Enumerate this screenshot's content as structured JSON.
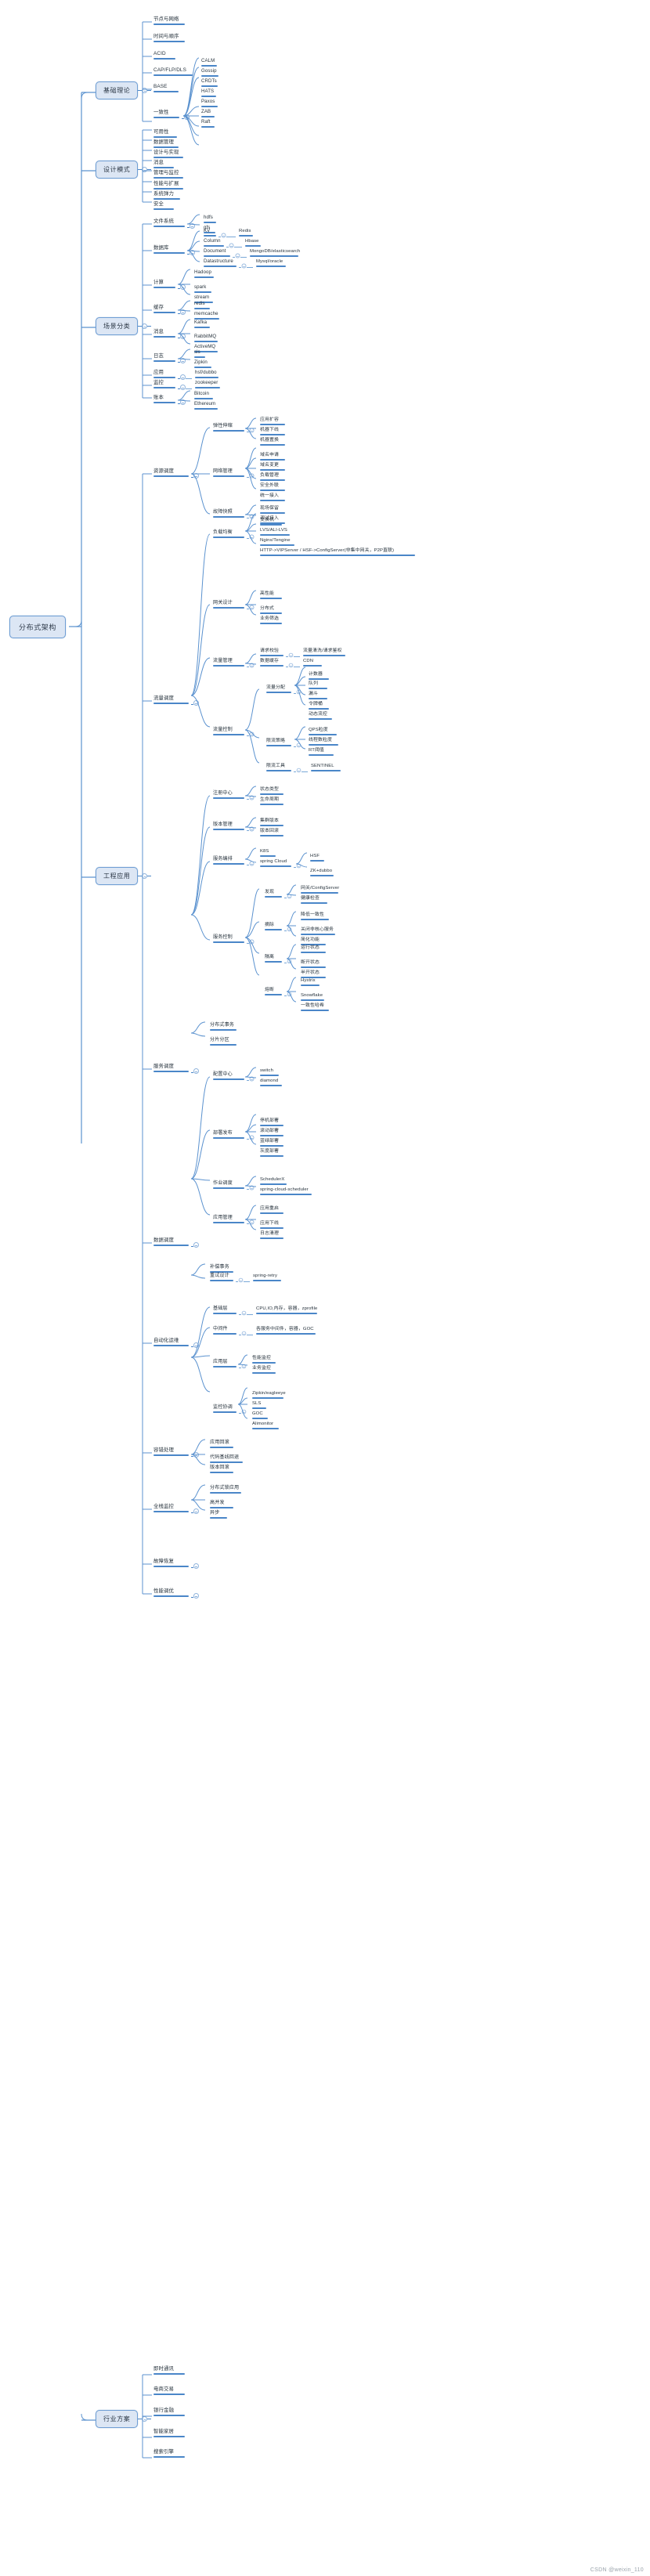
{
  "root": {
    "label": "分布式架构"
  },
  "watermark": "CSDN @weixin_110",
  "colors": {
    "branch": "#4a86c8",
    "pill_fill": "#dce6f4",
    "pill_border": "#6f9ed4",
    "text": "#26323c"
  },
  "branches": [
    {
      "id": "basic-theory",
      "label": "基础理论",
      "children": [
        {
          "label": "节点与网络"
        },
        {
          "label": "时间与顺序"
        },
        {
          "label": "ACID"
        },
        {
          "label": "CAP/FLP/DLS"
        },
        {
          "label": "BASE"
        },
        {
          "label": "一致性",
          "children": [
            {
              "label": "CALM"
            },
            {
              "label": "Gossip"
            },
            {
              "label": "CRDTs"
            },
            {
              "label": "HATS"
            },
            {
              "label": "Paxos"
            },
            {
              "label": "ZAB"
            },
            {
              "label": "Raft"
            }
          ]
        }
      ]
    },
    {
      "id": "design-pattern",
      "label": "设计模式",
      "children": [
        {
          "label": "可用性"
        },
        {
          "label": "数据管理"
        },
        {
          "label": "设计与实现"
        },
        {
          "label": "消息"
        },
        {
          "label": "管理与监控"
        },
        {
          "label": "性能与扩展"
        },
        {
          "label": "系统弹力"
        },
        {
          "label": "安全"
        }
      ]
    },
    {
      "id": "scenario",
      "label": "场景分类",
      "children": [
        {
          "label": "文件系统",
          "children": [
            {
              "label": "hdfs"
            },
            {
              "label": "gfs"
            }
          ]
        },
        {
          "label": "数据库",
          "children": [
            {
              "label": "KV",
              "children": [
                {
                  "label": "Redis"
                }
              ]
            },
            {
              "label": "Column",
              "children": [
                {
                  "label": "Hbase"
                }
              ]
            },
            {
              "label": "Document",
              "children": [
                {
                  "label": "MongoDB/elasticsearch"
                }
              ]
            },
            {
              "label": "Datastructure",
              "children": [
                {
                  "label": "Mysql/oracle"
                }
              ]
            }
          ]
        },
        {
          "label": "计算",
          "children": [
            {
              "label": "Hadoop"
            },
            {
              "label": "spark"
            },
            {
              "label": "stream"
            }
          ]
        },
        {
          "label": "缓存",
          "children": [
            {
              "label": "redis"
            },
            {
              "label": "memcache"
            }
          ]
        },
        {
          "label": "消息",
          "children": [
            {
              "label": "Kafka"
            },
            {
              "label": "RabbitMQ"
            },
            {
              "label": "ActiveMQ"
            }
          ]
        },
        {
          "label": "日志",
          "children": [
            {
              "label": "sls"
            },
            {
              "label": "Zipkin"
            }
          ]
        },
        {
          "label": "应用",
          "children": [
            {
              "label": "hsf/dubbo"
            }
          ]
        },
        {
          "label": "监控",
          "children": [
            {
              "label": "zookeeper"
            }
          ]
        },
        {
          "label": "账本",
          "children": [
            {
              "label": "Bitcoin"
            },
            {
              "label": "Ethereum"
            }
          ]
        }
      ]
    },
    {
      "id": "engineering",
      "label": "工程应用",
      "children": [
        {
          "label": "资源调度",
          "children": [
            {
              "label": "弹性伸缩",
              "children": [
                {
                  "label": "应用扩容"
                },
                {
                  "label": "机器下线"
                },
                {
                  "label": "机器置换"
                }
              ]
            },
            {
              "label": "网络管理",
              "children": [
                {
                  "label": "域名申请"
                },
                {
                  "label": "域名变更"
                },
                {
                  "label": "负载管理"
                },
                {
                  "label": "安全外联"
                },
                {
                  "label": "统一接入"
                }
              ]
            },
            {
              "label": "故障快照",
              "children": [
                {
                  "label": "现场保留"
                },
                {
                  "label": "调试接入"
                }
              ]
            }
          ]
        },
        {
          "label": "流量调度",
          "children": [
            {
              "label": "负载均衡",
              "children": [
                {
                  "label": "交换机"
                },
                {
                  "label": "LVS/ALI-LVS"
                },
                {
                  "label": "Nginx/Tengine"
                },
                {
                  "label": "HTTP->VIPServer / HSF->ConfigServer(非集中网关，P2P直联)"
                }
              ]
            },
            {
              "label": "网关设计",
              "children": [
                {
                  "label": "高性能"
                },
                {
                  "label": "分布式"
                },
                {
                  "label": "业务筛选"
                }
              ]
            },
            {
              "label": "流量管理",
              "children": [
                {
                  "label": "请求校验",
                  "children": [
                    {
                      "label": "流量清洗/请求鉴权"
                    }
                  ]
                },
                {
                  "label": "数据缓存",
                  "children": [
                    {
                      "label": "CDN"
                    }
                  ]
                }
              ]
            },
            {
              "label": "流量控制",
              "children": [
                {
                  "label": "流量分配",
                  "children": [
                    {
                      "label": "计数器"
                    },
                    {
                      "label": "队列"
                    },
                    {
                      "label": "漏斗"
                    },
                    {
                      "label": "令牌桶"
                    },
                    {
                      "label": "动态流控"
                    }
                  ]
                },
                {
                  "label": "限流策略",
                  "children": [
                    {
                      "label": "QPS粒度"
                    },
                    {
                      "label": "线程数粒度"
                    },
                    {
                      "label": "RT阈值"
                    }
                  ]
                },
                {
                  "label": "限流工具",
                  "children": [
                    {
                      "label": "SENTINEL"
                    }
                  ]
                }
              ]
            }
          ]
        },
        {
          "label": "服务调度",
          "children": [
            {
              "label": "注册中心",
              "children": [
                {
                  "label": "状态类型"
                },
                {
                  "label": "生命周期"
                }
              ]
            },
            {
              "label": "版本管理",
              "children": [
                {
                  "label": "集群版本"
                },
                {
                  "label": "版本回滚"
                }
              ]
            },
            {
              "label": "服务编排",
              "children": [
                {
                  "label": "K8S"
                },
                {
                  "label": "spring Cloud",
                  "children": [
                    {
                      "label": "HSF"
                    },
                    {
                      "label": "ZK+dubbo"
                    }
                  ]
                }
              ]
            },
            {
              "label": "服务控制",
              "children": [
                {
                  "label": "发现",
                  "children": [
                    {
                      "label": "网关/ConfigServer"
                    },
                    {
                      "label": "健康检查"
                    }
                  ]
                },
                {
                  "label": "摘除",
                  "children": [
                    {
                      "label": "降低一致性"
                    },
                    {
                      "label": "关闭非核心服务"
                    },
                    {
                      "label": "简化功能"
                    }
                  ]
                },
                {
                  "label": "隔离",
                  "children": [
                    {
                      "label": "运行状态"
                    },
                    {
                      "label": "断开状态"
                    },
                    {
                      "label": "半开状态"
                    }
                  ]
                },
                {
                  "label": "熔断",
                  "children": [
                    {
                      "label": "Hystrix"
                    },
                    {
                      "label": "Snowflake"
                    },
                    {
                      "label": "一致性哈希"
                    }
                  ]
                }
              ]
            }
          ]
        },
        {
          "label": "数据调度",
          "children": [
            {
              "label": "分布式事务"
            },
            {
              "label": "分片分区"
            }
          ]
        },
        {
          "label": "自动化运维",
          "children": [
            {
              "label": "配置中心",
              "children": [
                {
                  "label": "switch"
                },
                {
                  "label": "diamond"
                }
              ]
            },
            {
              "label": "部署发布",
              "children": [
                {
                  "label": "停机部署"
                },
                {
                  "label": "滚动部署"
                },
                {
                  "label": "蓝绿部署"
                },
                {
                  "label": "灰度部署"
                }
              ]
            },
            {
              "label": "作业调度",
              "children": [
                {
                  "label": "SchedulerX"
                },
                {
                  "label": "spring-cloud-scheduler"
                }
              ]
            },
            {
              "label": "应用管理",
              "children": [
                {
                  "label": "应用重启"
                },
                {
                  "label": "应用下线"
                },
                {
                  "label": "日志清理"
                }
              ]
            }
          ]
        },
        {
          "label": "容错处理",
          "children": [
            {
              "label": "补偿事务"
            },
            {
              "label": "重试设计",
              "children": [
                {
                  "label": "spring-retry"
                }
              ]
            }
          ]
        },
        {
          "label": "全栈监控",
          "children": [
            {
              "label": "基础层",
              "children": [
                {
                  "label": "CPU,IO,内存，容器，zprofile"
                }
              ]
            },
            {
              "label": "中间件",
              "children": [
                {
                  "label": "各服务中间件，容器，GOC"
                }
              ]
            },
            {
              "label": "应用层",
              "children": [
                {
                  "label": "性能监控"
                },
                {
                  "label": "业务监控"
                }
              ]
            },
            {
              "label": "监控协调",
              "children": [
                {
                  "label": "Zipkin/eagleeye"
                },
                {
                  "label": "SLS"
                },
                {
                  "label": "GOC"
                },
                {
                  "label": "Alimonitor"
                }
              ]
            }
          ]
        },
        {
          "label": "故障恢复",
          "children": [
            {
              "label": "应用回滚"
            },
            {
              "label": "代码基线回退"
            },
            {
              "label": "版本回滚"
            }
          ]
        },
        {
          "label": "性能调优",
          "children": [
            {
              "label": "分布式锁应用"
            },
            {
              "label": "高并发"
            },
            {
              "label": "异步"
            }
          ]
        }
      ]
    },
    {
      "id": "industry",
      "label": "行业方案",
      "children": [
        {
          "label": "即时通讯"
        },
        {
          "label": "电商交易"
        },
        {
          "label": "银行金融"
        },
        {
          "label": "智能家居"
        },
        {
          "label": "搜索引擎"
        }
      ]
    }
  ]
}
